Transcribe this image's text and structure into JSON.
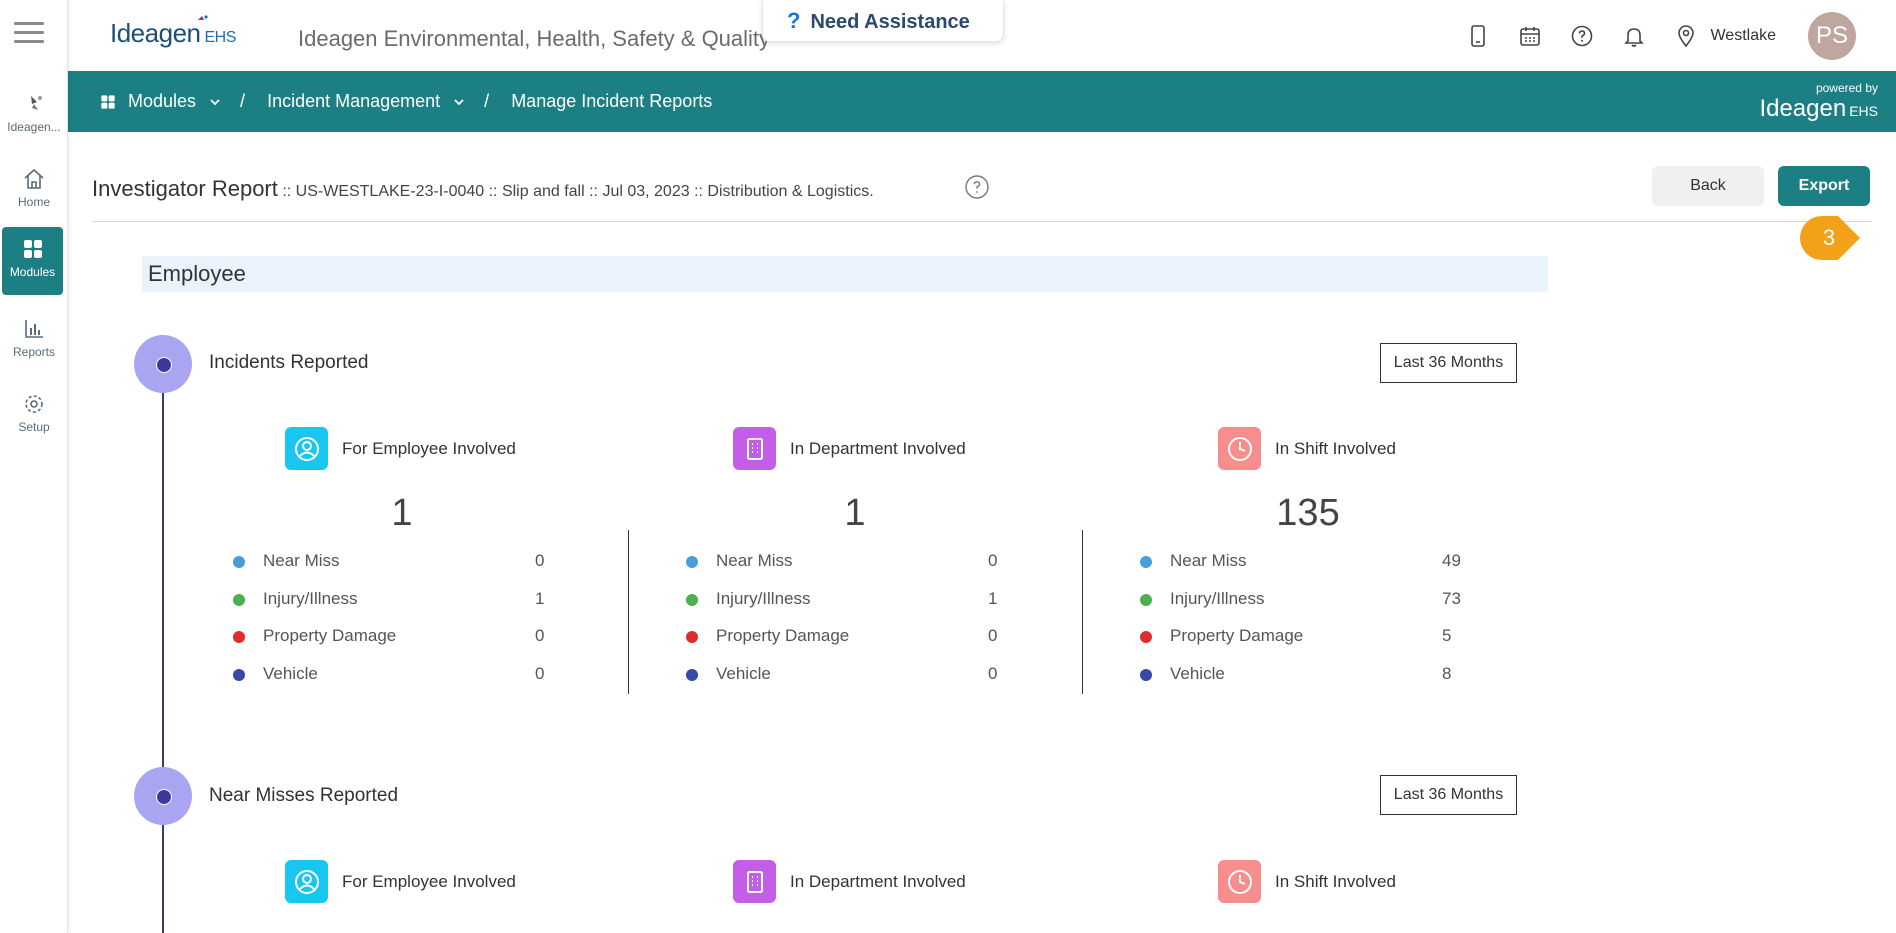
{
  "header": {
    "logo_text": "Ideagen",
    "logo_suffix": "EHS",
    "app_title": "Ideagen Environmental, Health, Safety & Quality",
    "assist_label": "Need Assistance",
    "location": "Westlake",
    "avatar_initials": "PS"
  },
  "rail": {
    "items": [
      {
        "label": "Ideagen..."
      },
      {
        "label": "Home"
      },
      {
        "label": "Modules"
      },
      {
        "label": "Reports"
      },
      {
        "label": "Setup"
      }
    ]
  },
  "breadcrumb": {
    "items": [
      "Modules",
      "Incident Management",
      "Manage Incident Reports"
    ],
    "sep": "/"
  },
  "powered": {
    "line1": "powered by",
    "line2": "Ideagen",
    "line2_suffix": "EHS"
  },
  "report": {
    "title": "Investigator Report",
    "meta": " :: US-WESTLAKE-23-I-0040 :: Slip and fall :: Jul 03, 2023 :: Distribution & Logistics.",
    "back_label": "Back",
    "export_label": "Export",
    "step_number": "3"
  },
  "section": {
    "title": "Employee"
  },
  "legend_colors": {
    "near_miss": "#4a9ed8",
    "injury": "#4caf50",
    "property": "#e02c2c",
    "vehicle": "#3848a8"
  },
  "blocks": [
    {
      "title": "Incidents Reported",
      "range": "Last 36 Months",
      "metrics": [
        {
          "label": "For Employee Involved",
          "icon": "user-circle-icon",
          "color": "#19c6f0",
          "total": "1",
          "rows": [
            {
              "label": "Near Miss",
              "value": "0"
            },
            {
              "label": "Injury/Illness",
              "value": "1"
            },
            {
              "label": "Property Damage",
              "value": "0"
            },
            {
              "label": "Vehicle",
              "value": "0"
            }
          ]
        },
        {
          "label": "In Department Involved",
          "icon": "building-icon",
          "color": "#c45ee8",
          "total": "1",
          "rows": [
            {
              "label": "Near Miss",
              "value": "0"
            },
            {
              "label": "Injury/Illness",
              "value": "1"
            },
            {
              "label": "Property Damage",
              "value": "0"
            },
            {
              "label": "Vehicle",
              "value": "0"
            }
          ]
        },
        {
          "label": "In Shift Involved",
          "icon": "clock-icon",
          "color": "#f78d8d",
          "total": "135",
          "rows": [
            {
              "label": "Near Miss",
              "value": "49"
            },
            {
              "label": "Injury/Illness",
              "value": "73"
            },
            {
              "label": "Property Damage",
              "value": "5"
            },
            {
              "label": "Vehicle",
              "value": "8"
            }
          ]
        }
      ]
    },
    {
      "title": "Near Misses Reported",
      "range": "Last 36 Months",
      "metrics": [
        {
          "label": "For Employee Involved"
        },
        {
          "label": "In Department Involved"
        },
        {
          "label": "In Shift Involved"
        }
      ]
    }
  ]
}
